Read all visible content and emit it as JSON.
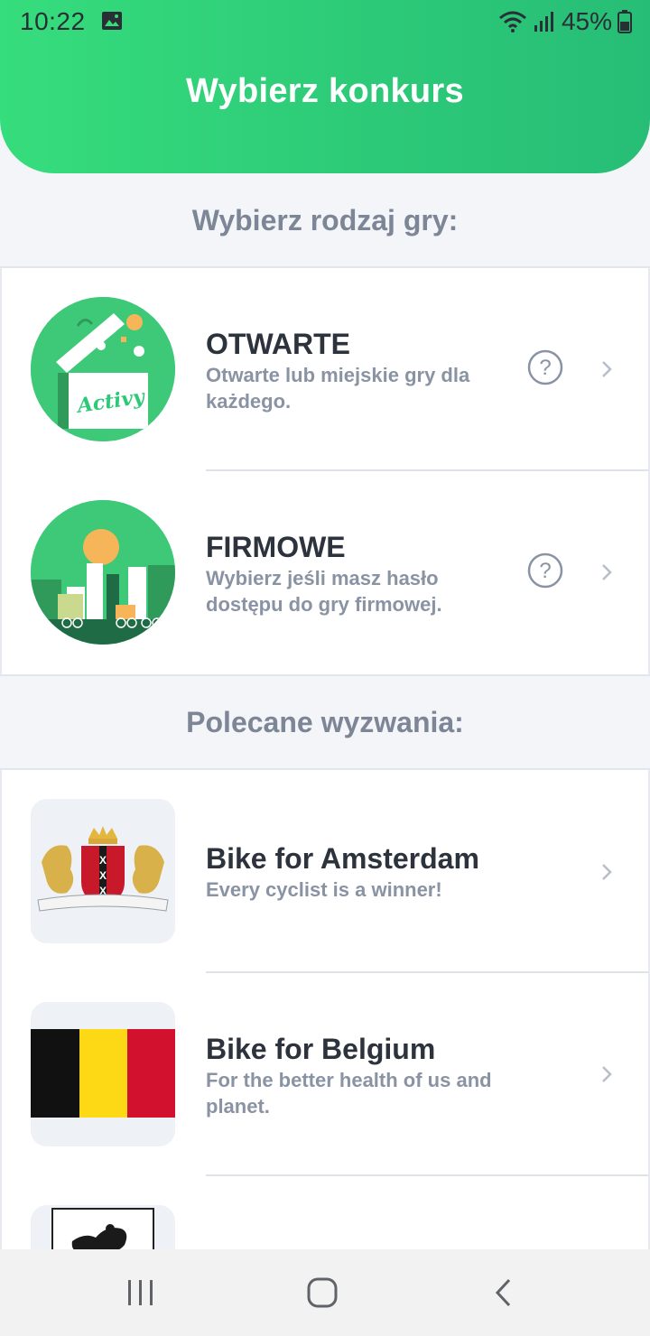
{
  "status_bar": {
    "time": "10:22",
    "battery": "45%",
    "icons": [
      "image-icon",
      "wifi-icon",
      "signal-icon",
      "battery-icon"
    ]
  },
  "header": {
    "title": "Wybierz konkurs"
  },
  "game_types": {
    "section_title": "Wybierz rodzaj gry:",
    "items": [
      {
        "title": "OTWARTE",
        "description": "Otwarte lub miejskie gry dla każdego.",
        "thumbnail_text": "Activy"
      },
      {
        "title": "FIRMOWE",
        "description": "Wybierz jeśli masz hasło dostępu do gry firmowej."
      }
    ]
  },
  "challenges": {
    "section_title": "Polecane wyzwania:",
    "items": [
      {
        "title": "Bike for Amsterdam",
        "description": "Every cyclist is a winner!",
        "emblem_text": "VASTBERADEN HELDHAFTIG BARMHARTIG"
      },
      {
        "title": "Bike for Belgium",
        "description": "For the better health of us and planet."
      },
      {
        "title": "",
        "description": ""
      }
    ]
  },
  "colors": {
    "accent_green": "#2cc978",
    "title_text": "#2d333d",
    "muted_text": "#8a93a3",
    "belgium_black": "#111111",
    "belgium_yellow": "#fcd914",
    "belgium_red": "#d1112d"
  },
  "nav": {
    "buttons": [
      "recent-apps-icon",
      "home-icon",
      "back-icon"
    ]
  }
}
